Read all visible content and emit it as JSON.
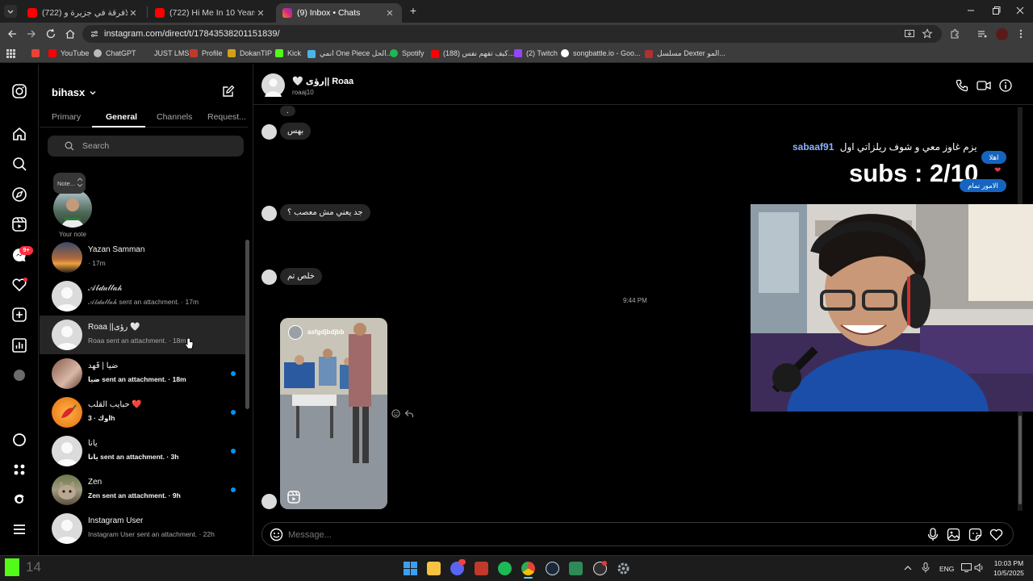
{
  "browser": {
    "tabs": [
      {
        "title": "(722) جمعت الافرقة في جزيرة و...",
        "active": false
      },
      {
        "title": "(722) Hi Me In 10 Years - YouTu...",
        "active": false
      },
      {
        "title": "(9) Inbox • Chats",
        "active": true
      }
    ],
    "url": "instagram.com/direct/t/17843538201151839/",
    "bookmarks": [
      "YouTube",
      "ChatGPT",
      "JUST LMS",
      "Profile",
      "DokanTIP",
      "Kick",
      "انمي One Piece الحل...",
      "Spotify",
      "(188) كيف تفهم نفس...",
      "(2) Twitch",
      "songbattle.io - Goo...",
      "مسلسل Dexter المو..."
    ]
  },
  "sidebar": {
    "messages_badge": "9+"
  },
  "inbox": {
    "username": "bihasx",
    "tabs": [
      "Primary",
      "General",
      "Channels",
      "Request..."
    ],
    "active_tab": "General",
    "search_placeholder": "Search",
    "note": {
      "bubble": "Note...",
      "label": "Your note"
    },
    "conversations": [
      {
        "name": "Yazan Samman",
        "preview": "· 17m",
        "unread": false,
        "selected": false
      },
      {
        "name": "𝒜𝒷𝒹𝓊𝓁𝓁𝒶𝒽",
        "preview": "𝒜𝒷𝒹𝓊𝓁𝓁𝒶𝒽 sent an attachment. · 17m",
        "unread": false,
        "selected": false
      },
      {
        "name": "Roaa ||رؤى 🤍",
        "preview": "Roaa sent an attachment. · 18m",
        "unread": false,
        "selected": true
      },
      {
        "name": "ضيا | قَهد",
        "preview": "ضيا sent an attachment. · 18m",
        "unread": true,
        "selected": false
      },
      {
        "name": "حبايب القلب ❤️",
        "preview": "اوك · 3h",
        "unread": true,
        "selected": false
      },
      {
        "name": "يانا",
        "preview": "يانا sent an attachment. · 3h",
        "unread": true,
        "selected": false
      },
      {
        "name": "Zen",
        "preview": "Zen sent an attachment. · 9h",
        "unread": true,
        "selected": false
      },
      {
        "name": "Instagram User",
        "preview": "Instagram User sent an attachment. · 22h",
        "unread": false,
        "selected": false
      }
    ]
  },
  "chat": {
    "name": "🤍 رؤى|| Roaa",
    "handle": "roaaj10",
    "messages": [
      {
        "text": "."
      },
      {
        "text": "بهس"
      },
      {
        "text": "جد يعني مش معصب ؟"
      },
      {
        "text": "خلص تم"
      }
    ],
    "timestamp": "9:44 PM",
    "reel_account": "asfgdjbdjbb",
    "composer_placeholder": "Message..."
  },
  "overlay": {
    "marquee": "يزم غاوز معي و شوف ريلزاتي اول",
    "marquee_user": "sabaaf91",
    "subs": "subs : 2/10",
    "badge_hello": "اهلا",
    "badge_ok": "الامور تمام"
  },
  "taskbar": {
    "stream_count": "14",
    "lang": "ENG",
    "time": "10:03 PM",
    "date": "10/5/2025"
  },
  "colors": {
    "accent": "#0095f6",
    "badge": "#ff3040"
  }
}
